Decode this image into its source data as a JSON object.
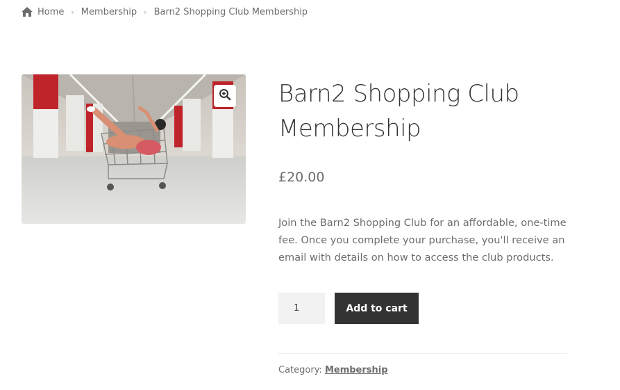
{
  "breadcrumb": {
    "home": "Home",
    "category": "Membership",
    "current": "Barn2 Shopping Club Membership"
  },
  "product": {
    "title": "Barn2 Shopping Club Membership",
    "price": "£20.00",
    "description": "Join the Barn2 Shopping Club for an affordable, one-time fee. Once you complete your purchase, you'll receive an email with details on how to access the club products.",
    "quantity": "1",
    "add_to_cart_label": "Add to cart",
    "category_label": "Category: ",
    "category_value": "Membership"
  },
  "colors": {
    "button_bg": "#333333",
    "text": "#6d6d6d",
    "title": "#333333"
  }
}
